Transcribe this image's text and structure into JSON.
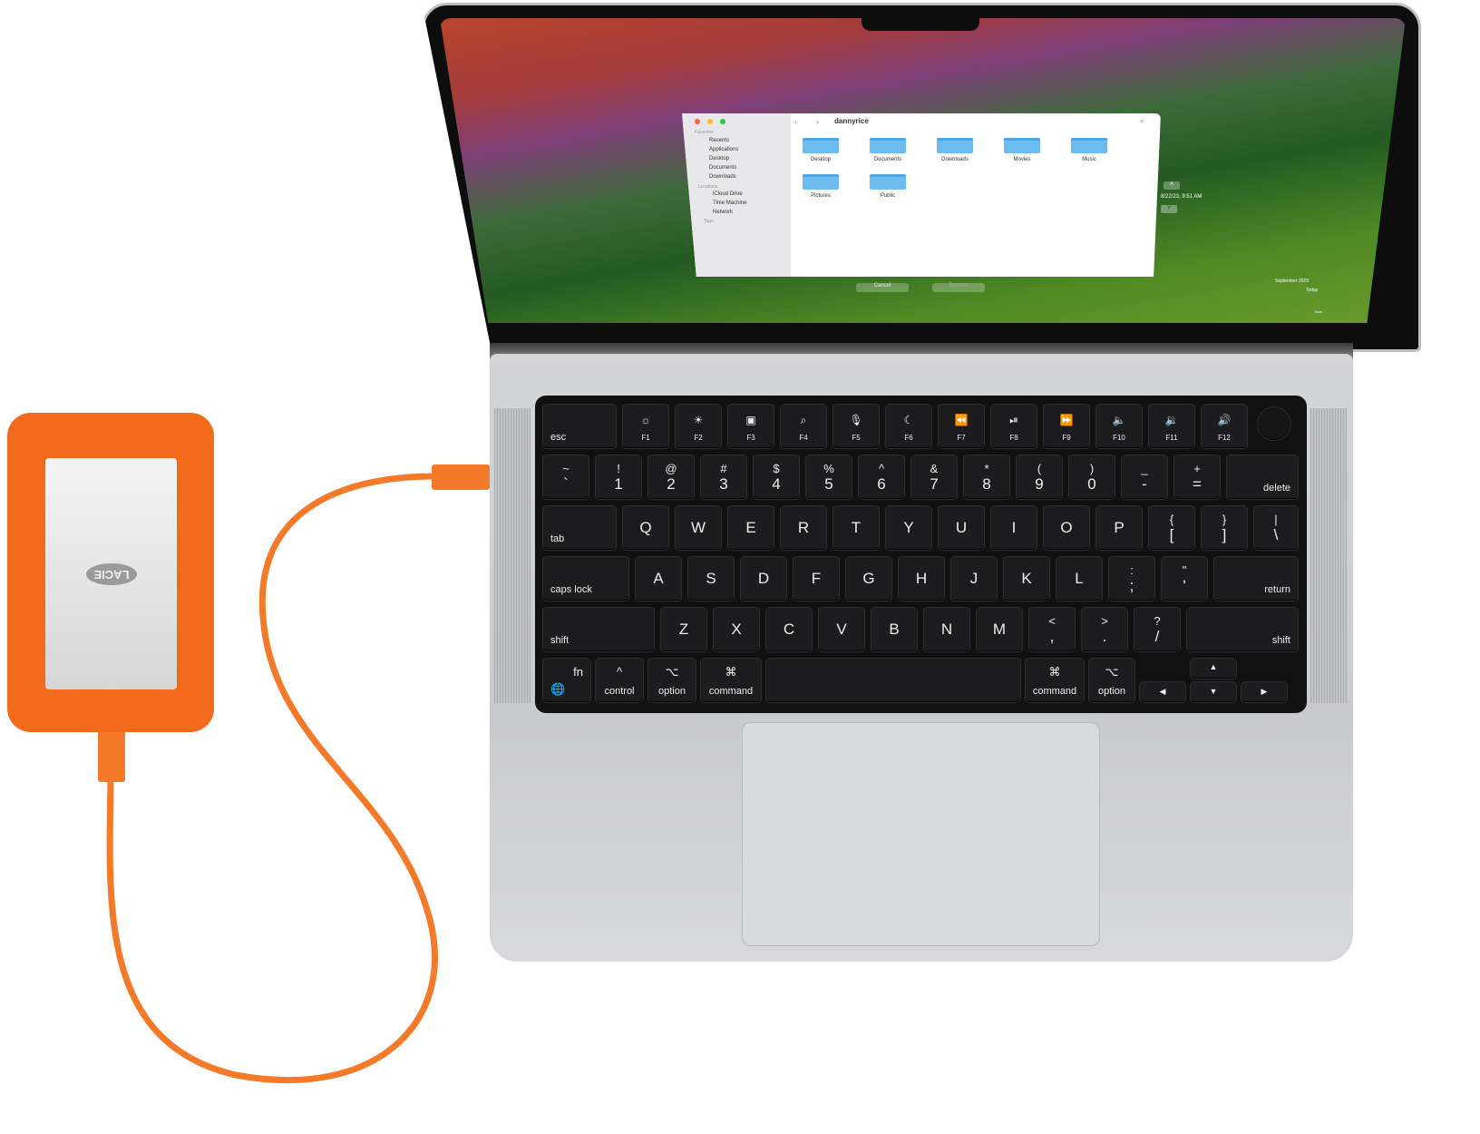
{
  "finder": {
    "title": "dannyrice",
    "sidebar": {
      "favorites_header": "Favorites",
      "favorites": [
        "Recents",
        "Applications",
        "Desktop",
        "Documents",
        "Downloads"
      ],
      "locations_header": "Locations",
      "locations": [
        "iCloud Drive",
        "Time Machine",
        "Network"
      ],
      "tags_header": "Tags"
    },
    "folders": [
      "Desktop",
      "Documents",
      "Downloads",
      "Movies",
      "Music",
      "Pictures",
      "Public"
    ],
    "cancel": "Cancel",
    "restore": "Restore"
  },
  "time_machine": {
    "snapshot": "8/22/23, 9:51 AM",
    "timeline": [
      "September 2023",
      "Today",
      "Now"
    ]
  },
  "drive": {
    "brand": "LACIE",
    "color": "#f26a1b"
  },
  "keyboard": {
    "row1": [
      [
        "",
        "esc"
      ],
      [
        "☼",
        "F1"
      ],
      [
        "☀",
        "F2"
      ],
      [
        "▣",
        "F3"
      ],
      [
        "⌕",
        "F4"
      ],
      [
        "🎙",
        "F5"
      ],
      [
        "☾",
        "F6"
      ],
      [
        "⏪",
        "F7"
      ],
      [
        "⏯",
        "F8"
      ],
      [
        "⏩",
        "F9"
      ],
      [
        "🔈",
        "F10"
      ],
      [
        "🔉",
        "F11"
      ],
      [
        "🔊",
        "F12"
      ]
    ],
    "row2": [
      [
        "~",
        "`"
      ],
      [
        "!",
        "1"
      ],
      [
        "@",
        "2"
      ],
      [
        "#",
        "3"
      ],
      [
        "$",
        "4"
      ],
      [
        "%",
        "5"
      ],
      [
        "^",
        "6"
      ],
      [
        "&",
        "7"
      ],
      [
        "*",
        "8"
      ],
      [
        "(",
        "9"
      ],
      [
        ")",
        "0"
      ],
      [
        "_",
        "-"
      ],
      [
        "+",
        "="
      ],
      [
        "",
        "delete"
      ]
    ],
    "row3": [
      [
        "",
        "tab"
      ],
      [
        "",
        "Q"
      ],
      [
        "",
        "W"
      ],
      [
        "",
        "E"
      ],
      [
        "",
        "R"
      ],
      [
        "",
        "T"
      ],
      [
        "",
        "Y"
      ],
      [
        "",
        "U"
      ],
      [
        "",
        "I"
      ],
      [
        "",
        "O"
      ],
      [
        "",
        "P"
      ],
      [
        "{",
        "["
      ],
      [
        "}",
        "]"
      ],
      [
        "|",
        "\\"
      ]
    ],
    "row4": [
      [
        "",
        "caps lock"
      ],
      [
        "",
        "A"
      ],
      [
        "",
        "S"
      ],
      [
        "",
        "D"
      ],
      [
        "",
        "F"
      ],
      [
        "",
        "G"
      ],
      [
        "",
        "H"
      ],
      [
        "",
        "J"
      ],
      [
        "",
        "K"
      ],
      [
        "",
        "L"
      ],
      [
        ":",
        ";"
      ],
      [
        "\"",
        "'"
      ],
      [
        "",
        "return"
      ]
    ],
    "row5": [
      [
        "",
        "shift"
      ],
      [
        "",
        "Z"
      ],
      [
        "",
        "X"
      ],
      [
        "",
        "C"
      ],
      [
        "",
        "V"
      ],
      [
        "",
        "B"
      ],
      [
        "",
        "N"
      ],
      [
        "",
        "M"
      ],
      [
        "<",
        ","
      ],
      [
        ">",
        "."
      ],
      [
        "?",
        "/"
      ],
      [
        "",
        "shift"
      ]
    ],
    "row6": [
      [
        "fn",
        "🌐"
      ],
      [
        "^",
        "control"
      ],
      [
        "⌥",
        "option"
      ],
      [
        "⌘",
        "command"
      ],
      [
        "",
        ""
      ],
      [
        "⌘",
        "command"
      ],
      [
        "⌥",
        "option"
      ],
      [
        "",
        "◀"
      ],
      [
        "▲",
        "▼"
      ],
      [
        "",
        "▶"
      ]
    ]
  }
}
